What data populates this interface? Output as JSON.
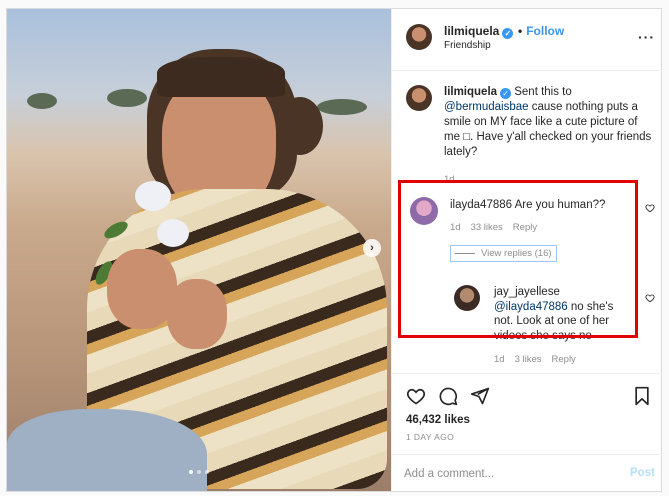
{
  "header": {
    "username": "lilmiquela",
    "follow_label": "Follow",
    "separator": "•",
    "subtitle": "Friendship",
    "more_label": "···"
  },
  "caption": {
    "username": "lilmiquela",
    "text_before": " Sent this to ",
    "mention": "@bermudaisbae",
    "text_after": " cause nothing puts a smile on MY face like a cute picture of me □. Have y'all checked on your friends lately?",
    "time": "1d"
  },
  "comments": [
    {
      "username": "ilayda47886",
      "text": "Are you human??",
      "time": "1d",
      "likes": "33 likes",
      "reply_label": "Reply",
      "view_replies": "View replies (16)"
    },
    {
      "username": "jay_jayellese",
      "mention": "@ilayda47886",
      "text": " no she's not. Look at one of her videos she says no",
      "time": "1d",
      "likes": "3 likes",
      "reply_label": "Reply"
    }
  ],
  "actions": {
    "likes": "46,432 likes",
    "time_ago": "1 DAY AGO",
    "comment_placeholder": "Add a comment...",
    "post_label": "Post"
  },
  "carousel": {
    "next_label": "›",
    "slide_count": 3,
    "active_slide": 1
  },
  "colors": {
    "accent": "#3897f0",
    "highlight_border": "#e00000",
    "muted": "#8e8e8e",
    "mention": "#00376b"
  },
  "icons": [
    "verified-icon",
    "more-icon",
    "heart-icon",
    "comment-icon",
    "share-icon",
    "bookmark-icon",
    "next-arrow-icon"
  ]
}
